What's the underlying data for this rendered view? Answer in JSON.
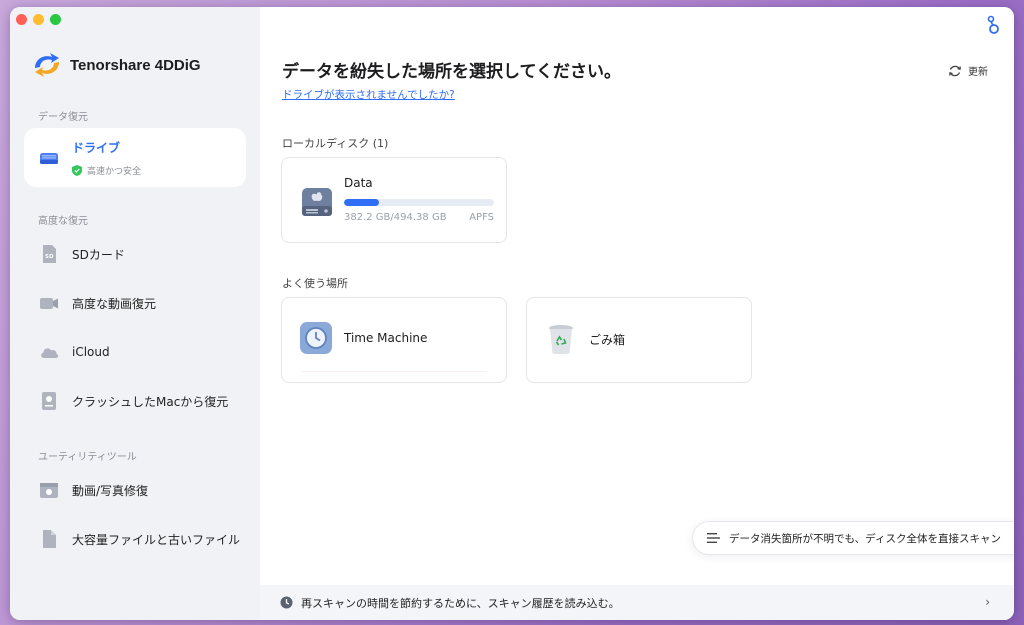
{
  "app": {
    "brand_name": "Tenorshare 4DDiG",
    "accent_color": "#2f6ef5"
  },
  "sidebar": {
    "sections": [
      {
        "label": "データ復元"
      },
      {
        "label": "高度な復元"
      },
      {
        "label": "ユーティリティツール"
      }
    ],
    "active_item": {
      "label": "ドライブ",
      "subtitle": "高速かつ安全",
      "icon": "drive-icon"
    },
    "advanced_items": [
      {
        "label": "SDカード",
        "icon": "sd-card-icon"
      },
      {
        "label": "高度な動画復元",
        "icon": "video-camera-icon"
      },
      {
        "label": "iCloud",
        "icon": "cloud-icon"
      },
      {
        "label": "クラッシュしたMacから復元",
        "icon": "crashed-mac-icon"
      }
    ],
    "utility_items": [
      {
        "label": "動画/写真修復",
        "icon": "photo-repair-icon"
      },
      {
        "label": "大容量ファイルと古いファイル",
        "icon": "file-icon"
      }
    ]
  },
  "main": {
    "title": "データを紛失した場所を選択してください。",
    "help_link": "ドライブが表示されませんでしたか?",
    "refresh_label": "更新",
    "local_disks_label": "ローカルディスク (1)",
    "disks": [
      {
        "name": "Data",
        "used_fraction": 0.23,
        "size_text": "382.2 GB/494.38 GB",
        "fs": "APFS"
      }
    ],
    "common_label": "よく使う場所",
    "common_locations": [
      {
        "name": "Time Machine",
        "icon": "time-machine-icon"
      },
      {
        "name": "ごみ箱",
        "icon": "trash-icon"
      }
    ],
    "fullscan_label": "データ消失箇所が不明でも、ディスク全体を直接スキャン",
    "footer_label": "再スキャンの時間を節約するために、スキャン履歴を読み込む。"
  }
}
